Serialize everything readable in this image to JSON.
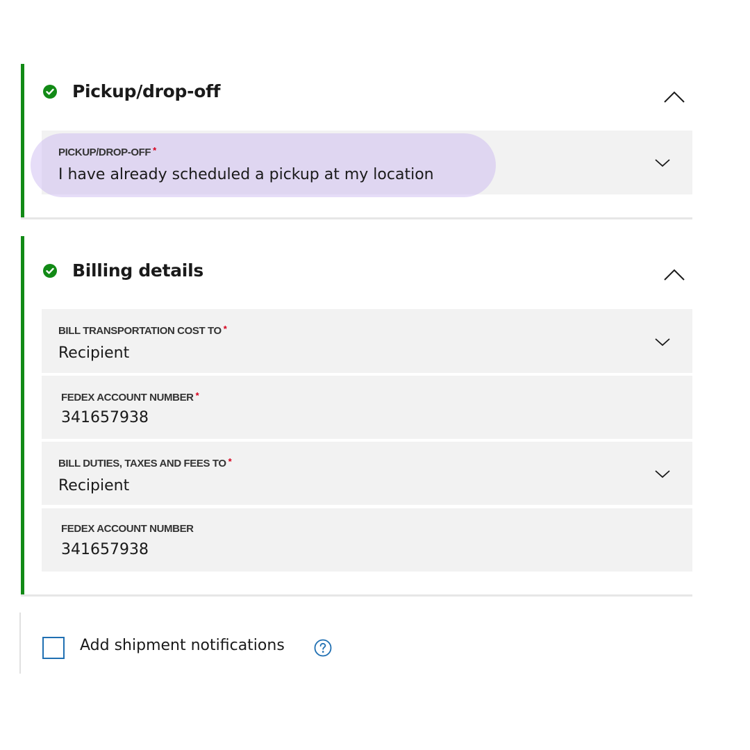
{
  "pickup": {
    "title": "Pickup/drop-off",
    "field": {
      "label": "PICKUP/DROP-OFF",
      "required_mark": "*",
      "value": "I have already scheduled a pickup at my location"
    }
  },
  "billing": {
    "title": "Billing details",
    "fields": [
      {
        "label": "BILL TRANSPORTATION COST TO",
        "required_mark": "*",
        "value": "Recipient"
      },
      {
        "label": "FEDEX ACCOUNT NUMBER",
        "required_mark": "*",
        "value": "341657938"
      },
      {
        "label": "BILL DUTIES, TAXES AND FEES TO",
        "required_mark": "*",
        "value": "Recipient"
      },
      {
        "label": "FEDEX ACCOUNT NUMBER",
        "required_mark": "",
        "value": "341657938"
      }
    ]
  },
  "notifications": {
    "label": "Add shipment notifications",
    "checked": false
  },
  "colors": {
    "accent_green": "#128a16",
    "required_red": "#d6001c",
    "checkbox_blue": "#1f6fb2",
    "highlight": "#d9cdf2"
  },
  "icons": {
    "section_status": "check-circle-icon",
    "collapse": "chevron-up-icon",
    "dropdown": "chevron-down-icon",
    "help": "question-circle-icon"
  }
}
